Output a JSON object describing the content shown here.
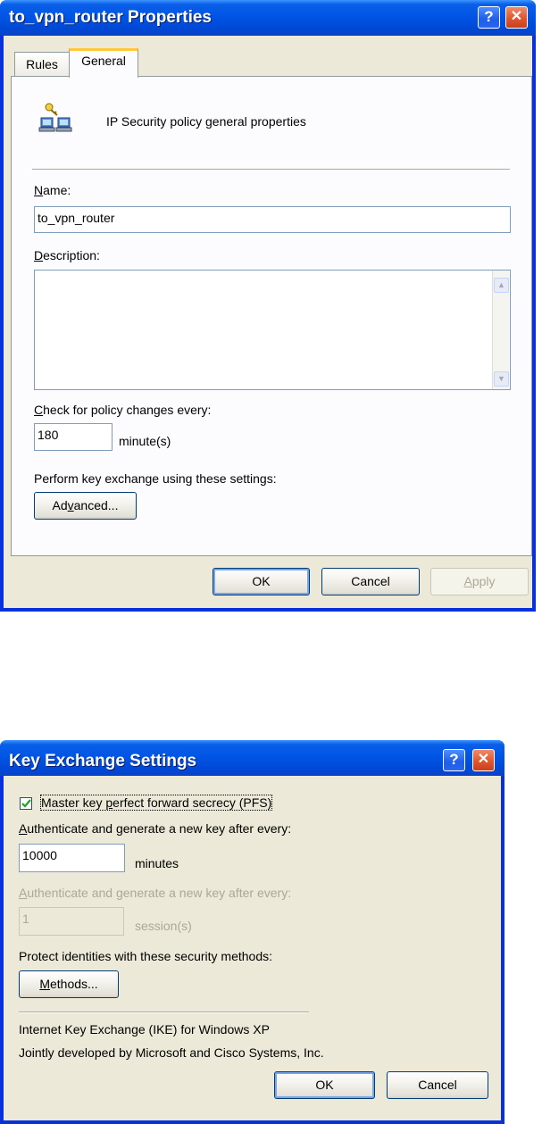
{
  "dialog1": {
    "title": "to_vpn_router Properties",
    "tabs": [
      "Rules",
      "General"
    ],
    "active_tab": "General",
    "header_text": "IP Security policy general properties",
    "name_label_key": "N",
    "name_label_rest": "ame:",
    "name_value": "to_vpn_router",
    "description_label_key": "D",
    "description_label_rest": "escription:",
    "description_value": "",
    "check_label_key": "C",
    "check_label_rest": "heck for policy changes every:",
    "interval_value": "180",
    "interval_unit": "minute(s)",
    "key_exchange_label": "Perform key exchange using these settings:",
    "advanced_pre": "Ad",
    "advanced_key": "v",
    "advanced_post": "anced...",
    "ok": "OK",
    "cancel": "Cancel",
    "apply_key": "A",
    "apply_rest": "pply",
    "help_glyph": "?",
    "close_glyph": "✕"
  },
  "dialog2": {
    "title": "Key Exchange Settings",
    "pfs_checked": true,
    "pfs_pre": "Master key ",
    "pfs_key": "p",
    "pfs_post": "erfect forward secrecy (PFS)",
    "auth_minutes_key": "A",
    "auth_minutes_rest": "uthenticate and generate a new key after every:",
    "minutes_value": "10000",
    "minutes_unit": "minutes",
    "auth_sessions_key": "A",
    "auth_sessions_rest": "uthenticate and generate a new key after every:",
    "sessions_value": "1",
    "sessions_unit": "session(s)",
    "protect_label": "Protect identities with these security methods:",
    "methods_key": "M",
    "methods_rest": "ethods...",
    "ike_line1": "Internet Key Exchange (IKE) for Windows XP",
    "ike_line2": "Jointly developed by Microsoft and Cisco Systems, Inc.",
    "ok": "OK",
    "cancel": "Cancel",
    "help_glyph": "?",
    "close_glyph": "✕"
  }
}
